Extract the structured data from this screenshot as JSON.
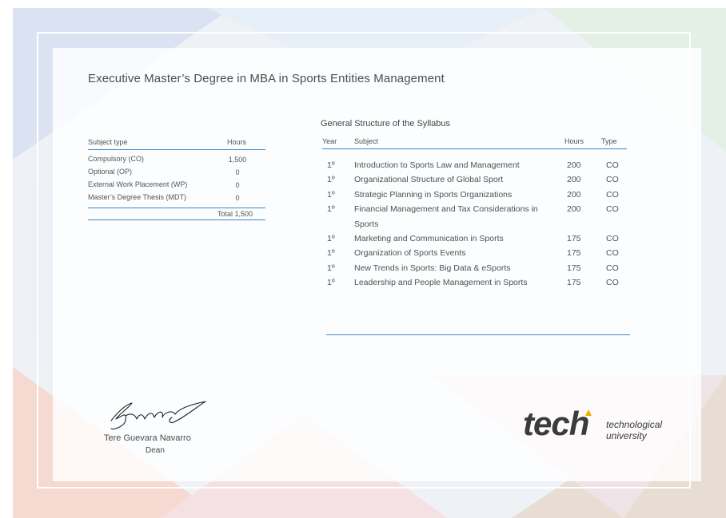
{
  "document": {
    "title": "Executive Master’s Degree in MBA in Sports Entities Management"
  },
  "summary": {
    "headers": {
      "subject_type": "Subject type",
      "hours": "Hours"
    },
    "rows": [
      {
        "type": "Compulsory (CO)",
        "hours": "1,500"
      },
      {
        "type": "Optional (OP)",
        "hours": "0"
      },
      {
        "type": "External Work Placement (WP)",
        "hours": "0"
      },
      {
        "type": "Master’s Degree Thesis (MDT)",
        "hours": "0"
      }
    ],
    "total": "Total 1,500"
  },
  "syllabus": {
    "title": "General Structure of the Syllabus",
    "headers": {
      "year": "Year",
      "subject": "Subject",
      "hours": "Hours",
      "type": "Type"
    },
    "rows": [
      {
        "year": "1º",
        "subject": "Introduction to Sports Law and Management",
        "hours": "200",
        "type": "CO"
      },
      {
        "year": "1º",
        "subject": "Organizational Structure of Global Sport",
        "hours": "200",
        "type": "CO"
      },
      {
        "year": "1º",
        "subject": "Strategic Planning in Sports Organizations",
        "hours": "200",
        "type": "CO"
      },
      {
        "year": "1º",
        "subject": "Financial Management and Tax Considerations in Sports",
        "hours": "200",
        "type": "CO"
      },
      {
        "year": "1º",
        "subject": "Marketing and Communication in Sports",
        "hours": "175",
        "type": "CO"
      },
      {
        "year": "1º",
        "subject": "Organization of Sports Events",
        "hours": "175",
        "type": "CO"
      },
      {
        "year": "1º",
        "subject": "New Trends in Sports: Big Data & eSports",
        "hours": "175",
        "type": "CO"
      },
      {
        "year": "1º",
        "subject": "Leadership and People Management in Sports",
        "hours": "175",
        "type": "CO"
      }
    ]
  },
  "signature": {
    "name": "Tere Guevara Navarro",
    "role": "Dean"
  },
  "logo": {
    "wordmark": "tech",
    "tagline_line1": "technological",
    "tagline_line2": "university"
  },
  "colors": {
    "accent_blue": "#3d87c4",
    "logo_dot": "#f2a900",
    "text": "#4a4a4a"
  }
}
